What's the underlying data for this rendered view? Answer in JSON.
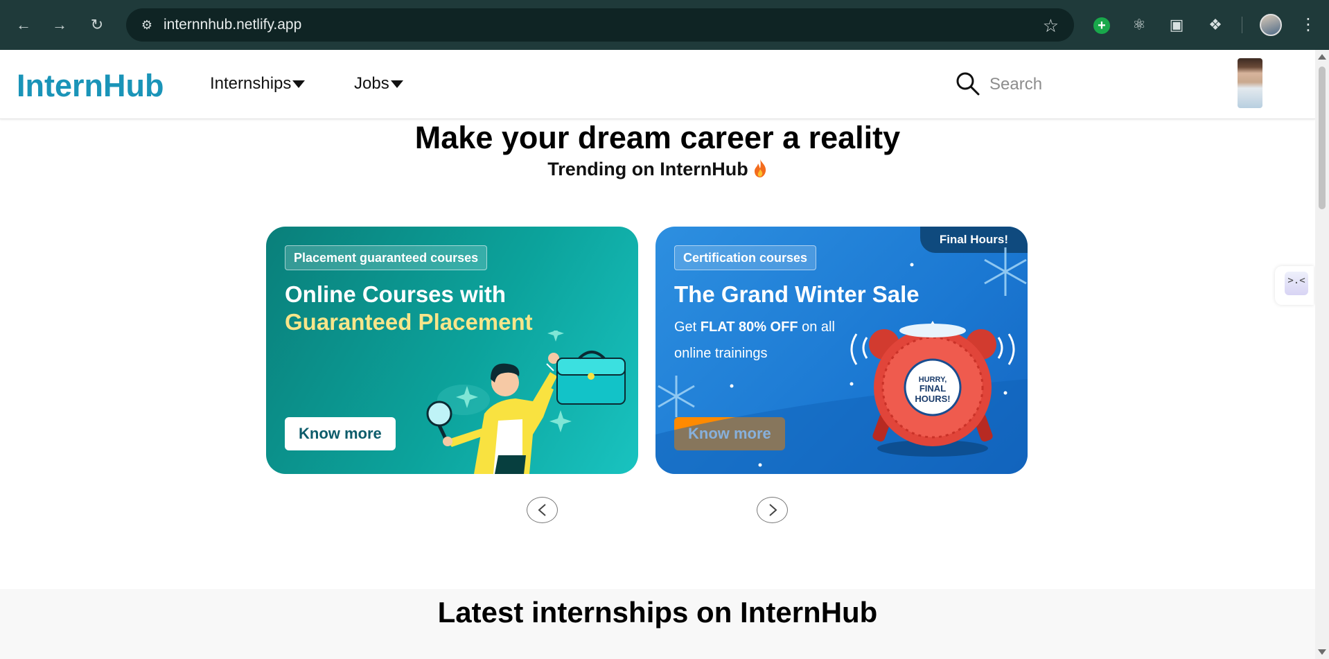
{
  "browser": {
    "url": "internnhub.netlify.app"
  },
  "header": {
    "logo": "InternHub",
    "nav": [
      "Internships",
      "Jobs"
    ],
    "search_placeholder": "Search"
  },
  "hero": {
    "title": "Make your dream career a reality",
    "subtitle": "Trending on InternHub"
  },
  "cards": [
    {
      "pill": "Placement guaranteed courses",
      "title_line1": "Online Courses with",
      "title_line2": "Guaranteed Placement",
      "button": "Know more"
    },
    {
      "pill": "Certification courses",
      "corner_badge": "Final Hours!",
      "title": "The Grand Winter Sale",
      "desc_prefix": "Get ",
      "desc_bold": "FLAT 80% OFF",
      "desc_suffix": " on all online trainings",
      "clock_text": [
        "HURRY,",
        "FINAL",
        "HOURS!"
      ],
      "button": "Know more"
    }
  ],
  "latest": {
    "title": "Latest internships on InternHub"
  },
  "colors": {
    "brand": "#1a94b8",
    "chrome": "#1f3a3a",
    "orange": "#ff8a00"
  }
}
